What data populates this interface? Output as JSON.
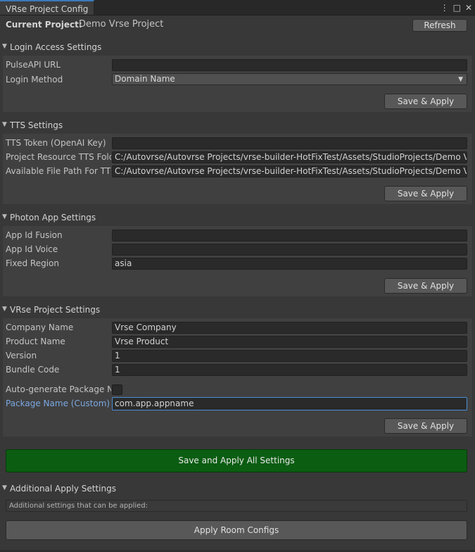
{
  "window": {
    "tab_title": "VRse Project Config",
    "icons": [
      "more-vertical-icon",
      "maximize-icon",
      "close-icon"
    ],
    "menu_glyph": "⋮",
    "maximize_glyph": "□",
    "close_glyph": "✕"
  },
  "current_project": {
    "label": "Current Project:",
    "value": "Demo Vrse Project",
    "refresh_label": "Refresh"
  },
  "login": {
    "title": "Login Access Settings",
    "pulse_label": "PulseAPI URL",
    "pulse_value": "",
    "method_label": "Login Method",
    "method_value": "Domain Name",
    "save_label": "Save & Apply"
  },
  "tts": {
    "title": "TTS Settings",
    "token_label": "TTS Token (OpenAI Key)",
    "token_value": "",
    "resource_label": "Project Resource TTS Fold",
    "resource_value": "C:/Autovrse/Autovrse Projects/vrse-builder-HotFixTest/Assets/StudioProjects/Demo Vrse",
    "avail_label": "Available File Path For TTS",
    "avail_value": "C:/Autovrse/Autovrse Projects/vrse-builder-HotFixTest/Assets/StudioProjects/Demo Vrse",
    "save_label": "Save & Apply"
  },
  "photon": {
    "title": "Photon App Settings",
    "fusion_label": "App Id Fusion",
    "fusion_value": "",
    "voice_label": "App Id Voice",
    "voice_value": "",
    "region_label": "Fixed Region",
    "region_value": "asia",
    "save_label": "Save & Apply"
  },
  "project": {
    "title": "VRse Project Settings",
    "company_label": "Company Name",
    "company_value": "Vrse Company",
    "product_label": "Product Name",
    "product_value": "Vrse Product",
    "version_label": "Version",
    "version_value": "1",
    "bundle_label": "Bundle Code",
    "bundle_value": "1",
    "autogen_label": "Auto-generate Package Na",
    "autogen_checked": false,
    "package_label": "Package Name (Custom)",
    "package_value": "com.app.appname",
    "save_label": "Save & Apply"
  },
  "save_all_label": "Save and Apply All Settings",
  "additional": {
    "title": "Additional Apply Settings",
    "help_text": "Additional settings that can be applied:",
    "room_label": "Apply Room Configs"
  },
  "colors": {
    "accent_green": "#0b5d12",
    "focus_blue": "#4a8ed8",
    "tab_accent": "#3a79bb"
  }
}
